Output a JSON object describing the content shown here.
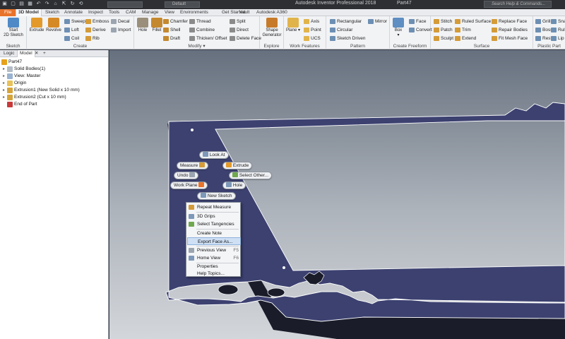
{
  "titlebar": {
    "title": "Autodesk Inventor Professional 2018",
    "document": "Part47",
    "help_placeholder": "Search Help & Commands...",
    "material_value": "",
    "appearance_value": "Default"
  },
  "tabs": [
    "File",
    "3D Model",
    "Sketch",
    "Annotate",
    "Inspect",
    "Tools",
    "CAM",
    "Manage",
    "View",
    "Environments",
    "Get Started",
    "Vault",
    "Autodesk A360"
  ],
  "ribbon": {
    "sketch": {
      "label": "Sketch",
      "start": "Start",
      "start2": "2D Sketch"
    },
    "create": {
      "label": "Create",
      "extrude": "Extrude",
      "revolve": "Revolve",
      "sweep": "Sweep",
      "loft": "Loft",
      "coil": "Coil",
      "emboss": "Emboss",
      "derive": "Derive",
      "rib": "Rib",
      "decal": "Decal",
      "import": "Import"
    },
    "modify": {
      "label": "Modify",
      "hole": "Hole",
      "fillet": "Fillet",
      "chamfer": "Chamfer",
      "shell": "Shell",
      "draft": "Draft",
      "thread": "Thread",
      "combine": "Combine",
      "thicken": "Thicken/ Offset",
      "split": "Split",
      "direct": "Direct",
      "delete_face": "Delete Face"
    },
    "explore": {
      "label": "Explore",
      "shape": "Shape",
      "generator": "Generator"
    },
    "work": {
      "label": "Work Features",
      "plane": "Plane",
      "axis": "Axis",
      "point": "Point",
      "ucs": "UCS"
    },
    "pattern": {
      "label": "Pattern",
      "rectangular": "Rectangular",
      "circular": "Circular",
      "sketch_driven": "Sketch Driven",
      "mirror": "Mirror"
    },
    "freeform": {
      "label": "Create Freeform",
      "box": "Box",
      "face": "Face",
      "convert": "Convert"
    },
    "surface": {
      "label": "Surface",
      "stitch": "Stitch",
      "patch": "Patch",
      "sculpt": "Sculpt",
      "ruled": "Ruled Surface",
      "trim": "Trim",
      "extend": "Extend",
      "replace": "Replace Face",
      "repair": "Repair Bodies",
      "fitmesh": "Fit Mesh Face"
    },
    "plastic": {
      "label": "Plastic Part",
      "grill": "Grill",
      "boss": "Boss",
      "rest": "Rest",
      "snap": "Snap",
      "rule": "Rule F",
      "lip": "Lip"
    }
  },
  "browser": {
    "tabs": [
      "Logic",
      "Model"
    ],
    "add": "+",
    "nodes": [
      "Part47",
      "Solid Bodies(1)",
      "View: Master",
      "Origin",
      "Extrusion1 (New Solid x 10 mm)",
      "Extrusion2 (Cut x 10 mm)",
      "End of Part"
    ]
  },
  "marking_menu": {
    "look_at": "Look At",
    "measure": "Measure",
    "extrude": "Extrude",
    "undo": "Undo",
    "select_other": "Select Other...",
    "work_plane": "Work Plane",
    "hole": "Hole",
    "new_sketch": "New Sketch"
  },
  "context_menu": {
    "repeat": "Repeat Measure",
    "grips": "3D Grips",
    "tangencies": "Select Tangencies",
    "create_note": "Create Note",
    "export_face": "Export Face As...",
    "previous_view": "Previous View",
    "previous_key": "F5",
    "home_view": "Home View",
    "home_key": "F6",
    "properties": "Properties",
    "help_topics": "Help Topics..."
  },
  "colors": {
    "accent": "#e8732a",
    "part": "#3c4170",
    "edge": "#ffffff"
  }
}
